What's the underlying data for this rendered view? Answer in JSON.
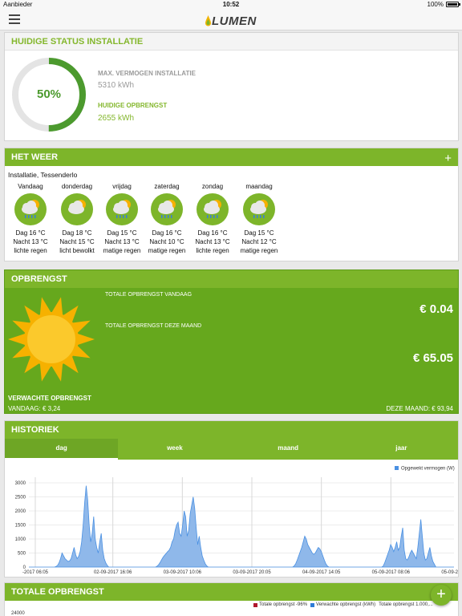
{
  "statusbar": {
    "carrier": "Aanbieder",
    "time": "10:52",
    "battery": "100%"
  },
  "app": {
    "logo": "LUMEN",
    "accent": "#7db52a"
  },
  "status": {
    "title": "HUIDIGE STATUS INSTALLATIE",
    "percent": "50%",
    "percent_value": 0.5,
    "max_label": "MAX. VERMOGEN INSTALLATIE",
    "max_value": "5310 kWh",
    "cur_label": "HUIDIGE OPBRENGST",
    "cur_value": "2655 kWh"
  },
  "weather": {
    "title": "HET WEER",
    "location": "Installatie, Tessenderlo",
    "days": [
      {
        "name": "Vandaag",
        "icon": "cloud-rain-sun-icon",
        "day": "Dag 16 °C",
        "night": "Nacht 13 °C",
        "desc": "lichte regen"
      },
      {
        "name": "donderdag",
        "icon": "cloud-sun-icon",
        "day": "Dag 18 °C",
        "night": "Nacht 15 °C",
        "desc": "licht bewolkt"
      },
      {
        "name": "vrijdag",
        "icon": "cloud-rain-sun-icon",
        "day": "Dag 15 °C",
        "night": "Nacht 13 °C",
        "desc": "matige regen"
      },
      {
        "name": "zaterdag",
        "icon": "cloud-rain-sun-icon",
        "day": "Dag 16 °C",
        "night": "Nacht 10 °C",
        "desc": "matige regen"
      },
      {
        "name": "zondag",
        "icon": "cloud-rain-sun-icon",
        "day": "Dag 16 °C",
        "night": "Nacht 13 °C",
        "desc": "lichte regen"
      },
      {
        "name": "maandag",
        "icon": "cloud-rain-sun-icon",
        "day": "Dag 15 °C",
        "night": "Nacht 12 °C",
        "desc": "matige regen"
      }
    ]
  },
  "opbrengst": {
    "title": "OPBRENGST",
    "today_label": "TOTALE OPBRENGST VANDAAG",
    "today_value": "€ 0.04",
    "month_label": "TOTALE OPBRENGST DEZE MAAND",
    "month_value": "€ 65.05",
    "expected_label": "VERWACHTE OPBRENGST",
    "expected_today": "VANDAAG: € 3,24",
    "expected_month": "DEZE MAAND: € 93,94"
  },
  "historiek": {
    "title": "HISTORIEK",
    "tabs": [
      "dag",
      "week",
      "maand",
      "jaar"
    ],
    "active_tab": 0
  },
  "chart_data": {
    "type": "area",
    "legend": [
      "Opgewekt vermogen (W)"
    ],
    "legend_position": "top-right",
    "series_color": "#4a90e2",
    "ylim": [
      0,
      3200
    ],
    "yticks": [
      0,
      500,
      1000,
      1500,
      2000,
      2500,
      3000
    ],
    "xticks": [
      "-2017 06:05",
      "02-09-2017 16:06",
      "03-09-2017 10:06",
      "03-09-2017 20:05",
      "04-09-2017 14:05",
      "05-09-2017 08:06",
      "05-09-2017 18:06"
    ],
    "x": [
      0,
      2,
      4,
      6,
      8,
      10,
      12,
      14,
      16,
      18,
      20,
      22,
      24,
      26,
      28,
      30,
      32,
      34,
      36,
      38,
      40,
      42,
      44,
      46,
      48,
      50,
      52,
      54,
      56,
      58,
      60,
      62,
      64,
      66,
      68,
      70,
      72,
      74,
      76,
      78,
      80,
      82,
      84,
      86,
      88,
      90,
      92,
      94,
      96,
      98,
      100,
      102,
      104,
      106,
      108,
      110,
      112,
      114,
      116,
      118,
      120,
      122,
      124,
      126,
      128,
      130,
      132,
      134,
      136,
      138,
      140,
      142,
      144,
      146,
      148,
      150,
      152,
      154,
      156,
      158,
      160,
      162,
      164,
      166,
      168,
      170,
      172,
      174,
      176,
      178,
      180,
      182,
      184,
      186,
      188,
      190,
      192,
      194,
      196,
      198,
      200,
      202,
      204,
      206,
      208,
      210,
      212,
      214,
      216,
      218,
      220,
      222,
      224,
      226,
      228,
      230,
      232,
      234,
      236,
      238,
      240,
      242,
      244,
      246,
      248,
      250,
      252,
      254,
      256,
      258,
      260,
      262,
      264,
      266,
      268,
      270,
      272,
      274,
      276,
      278,
      280,
      282,
      284,
      286,
      288,
      290,
      292,
      294,
      296,
      298,
      300,
      302,
      304,
      306,
      308,
      310,
      312,
      314,
      316,
      318,
      320,
      322,
      324,
      326,
      328,
      330,
      332,
      334,
      336,
      338,
      340,
      342,
      344,
      346,
      348,
      350,
      352,
      354,
      356,
      358,
      360,
      362,
      364,
      366,
      368,
      370,
      372,
      374,
      376,
      378,
      380,
      382,
      384,
      386,
      388,
      390,
      392,
      394,
      396,
      398,
      400,
      402,
      404,
      406,
      408,
      410,
      412,
      414,
      416,
      418,
      420,
      422,
      424,
      426,
      428,
      430,
      432,
      434,
      436,
      438,
      440,
      442,
      444,
      446,
      448,
      450,
      452,
      454,
      456,
      458,
      460,
      462,
      464,
      466,
      468,
      470,
      472,
      474,
      476,
      478,
      480,
      482,
      484,
      486,
      488,
      490,
      492,
      494,
      496,
      498,
      500,
      502,
      504,
      506,
      508,
      510,
      512,
      514,
      516,
      518,
      520,
      522,
      524,
      526,
      528,
      530,
      532,
      534,
      536,
      538,
      540,
      542,
      544,
      546,
      548,
      550,
      552,
      554,
      556,
      558,
      560,
      562,
      564
    ],
    "y": [
      0,
      0,
      0,
      0,
      0,
      0,
      0,
      0,
      0,
      0,
      0,
      0,
      0,
      0,
      0,
      0,
      0,
      0,
      20,
      60,
      150,
      300,
      500,
      400,
      300,
      250,
      200,
      220,
      300,
      500,
      700,
      450,
      300,
      380,
      550,
      900,
      1500,
      2300,
      2900,
      2400,
      1500,
      900,
      1200,
      1800,
      1000,
      700,
      500,
      900,
      1200,
      600,
      300,
      150,
      60,
      0,
      0,
      0,
      0,
      0,
      0,
      0,
      0,
      0,
      0,
      0,
      0,
      0,
      0,
      0,
      0,
      0,
      0,
      0,
      0,
      0,
      0,
      0,
      0,
      0,
      0,
      0,
      0,
      0,
      0,
      0,
      0,
      30,
      80,
      160,
      260,
      350,
      420,
      480,
      550,
      600,
      700,
      900,
      1000,
      1300,
      1500,
      1600,
      1200,
      1100,
      1500,
      2000,
      1800,
      1100,
      1300,
      1900,
      2200,
      2500,
      2100,
      1400,
      800,
      1100,
      700,
      400,
      250,
      120,
      40,
      0,
      0,
      0,
      0,
      0,
      0,
      0,
      0,
      0,
      0,
      0,
      0,
      0,
      0,
      0,
      0,
      0,
      0,
      0,
      0,
      0,
      0,
      0,
      0,
      0,
      0,
      0,
      0,
      0,
      0,
      0,
      0,
      0,
      0,
      0,
      0,
      0,
      0,
      0,
      0,
      0,
      0,
      0,
      0,
      0,
      0,
      0,
      0,
      0,
      0,
      0,
      0,
      0,
      0,
      0,
      0,
      0,
      40,
      120,
      250,
      400,
      550,
      700,
      900,
      1100,
      1000,
      800,
      700,
      600,
      500,
      450,
      500,
      600,
      700,
      650,
      550,
      400,
      250,
      120,
      40,
      0,
      0,
      0,
      0,
      0,
      0,
      0,
      0,
      0,
      0,
      0,
      0,
      0,
      0,
      0,
      0,
      0,
      0,
      0,
      0,
      0,
      0,
      0,
      0,
      0,
      0,
      0,
      0,
      0,
      0,
      0,
      0,
      0,
      0,
      0,
      0,
      30,
      150,
      300,
      450,
      600,
      800,
      700,
      550,
      700,
      900,
      600,
      700,
      1100,
      1400,
      600,
      300,
      250,
      350,
      500,
      600,
      500,
      400,
      300,
      700,
      1200,
      1700,
      1100,
      500,
      250,
      300,
      500,
      700,
      400,
      200,
      100,
      0,
      0,
      0,
      0,
      0,
      0,
      0,
      0,
      0,
      0,
      0,
      0,
      0,
      0,
      30,
      120,
      200
    ]
  },
  "totale": {
    "title": "TOTALE OPBRENGST",
    "legend": [
      "Totale opbrengst -96%",
      "Verwachte opbrengst (kWh)",
      "Totale opbrengst 1.000,..."
    ],
    "ytick_top": "24000"
  }
}
